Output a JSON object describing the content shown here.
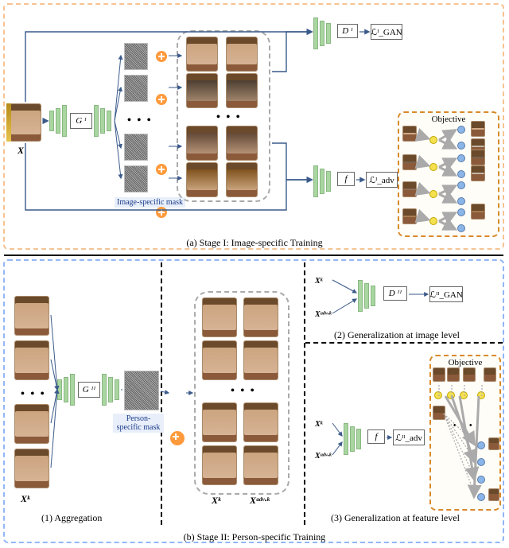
{
  "stageA": {
    "caption": "(a) Stage I: Image-specific Training",
    "var_X": "X",
    "g_label": "G ᴵ",
    "d_label": "D ᴵ",
    "f_label": "f",
    "loss_gan": "ℒᴵ_GAN",
    "loss_adv": "ℒᴵ_adv",
    "mask_label": "Image-specific mask",
    "obj_title": "Objective"
  },
  "stageB": {
    "caption": "(b) Stage II: Person-specific Training",
    "part1": "(1) Aggregation",
    "part2": "(2) Generalization at image level",
    "part3": "(3) Generalization at feature level",
    "var_Xk": "Xᵏ",
    "var_Xadvk": "Xᵃᵈᵛ·ᵏ",
    "g_label": "G ᴵᴵ",
    "d_label": "D ᴵᴵ",
    "f_label": "f",
    "loss_gan": "ℒᴵᴵ_GAN",
    "loss_adv": "ℒᴵᴵ_adv",
    "mask_label": "Person-specific mask",
    "obj_title": "Objective"
  }
}
